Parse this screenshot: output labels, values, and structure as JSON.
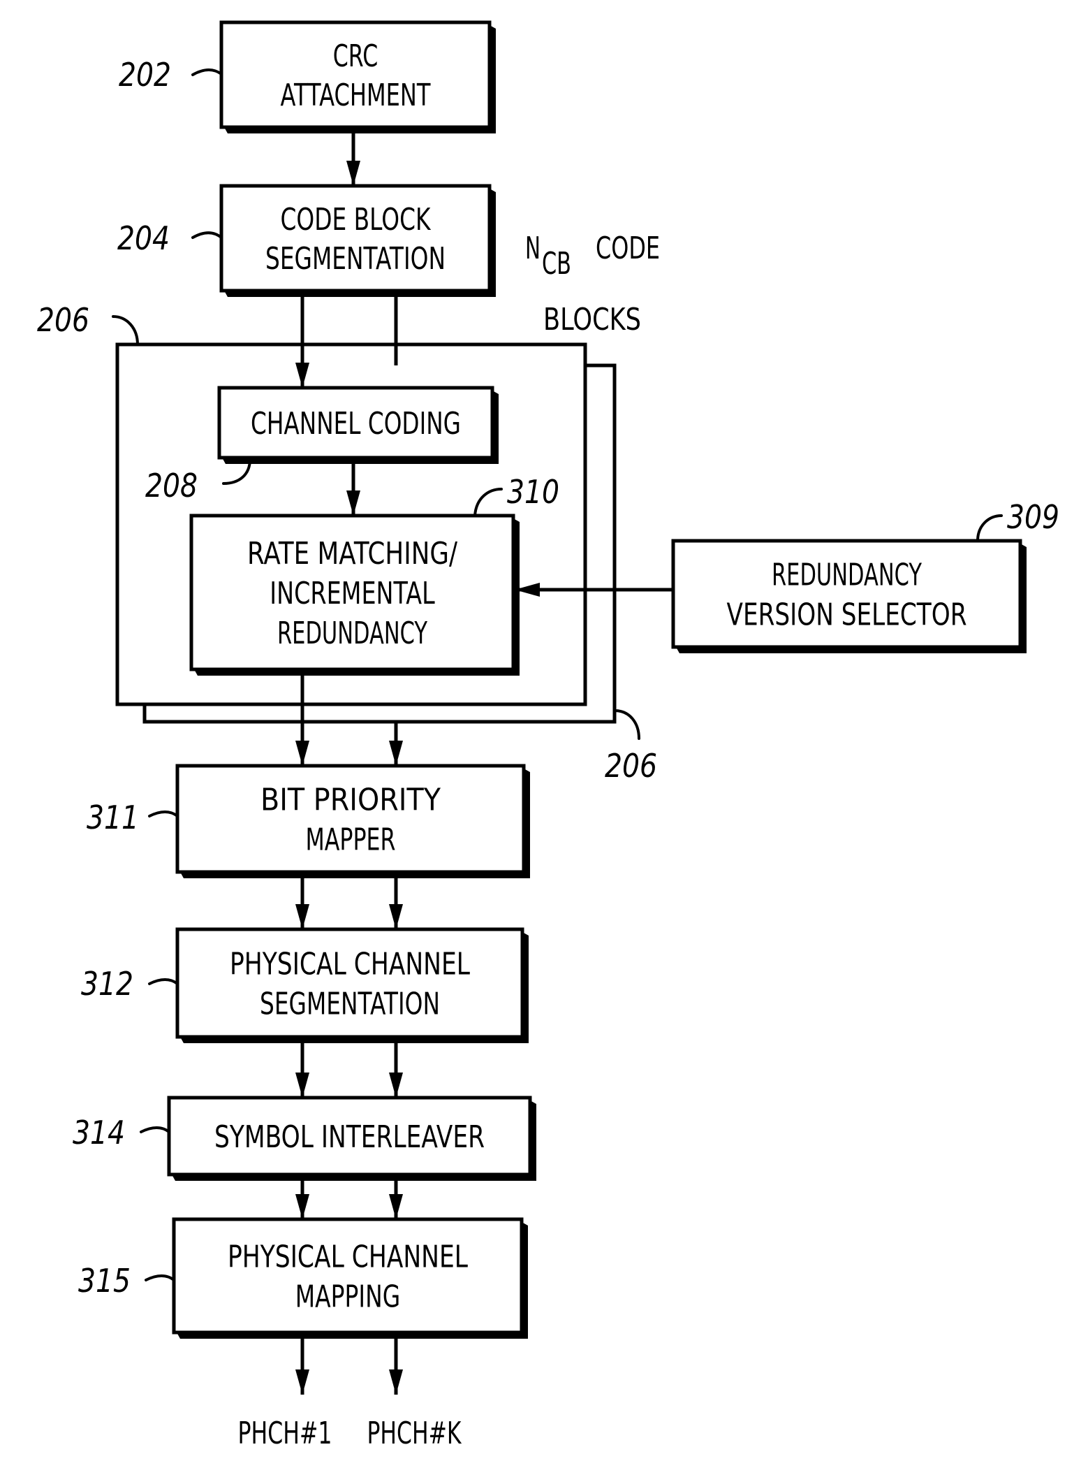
{
  "figure": {
    "type": "block-diagram",
    "description": "Transport channel processing chain with redundancy version selection"
  },
  "blocks": {
    "crc_attachment": {
      "ref": "202",
      "lines": [
        "CRC",
        "ATTACHMENT"
      ]
    },
    "code_block_segmentation": {
      "ref": "204",
      "lines": [
        "CODE BLOCK",
        "SEGMENTATION"
      ]
    },
    "per_code_block_container": {
      "ref_front": "206",
      "ref_back": "206"
    },
    "channel_coding": {
      "ref": "208",
      "lines": [
        "CHANNEL CODING"
      ]
    },
    "rate_matching": {
      "ref": "310",
      "lines": [
        "RATE MATCHING/",
        "INCREMENTAL",
        "REDUNDANCY"
      ]
    },
    "redundancy_version_selector": {
      "ref": "309",
      "lines": [
        "REDUNDANCY",
        "VERSION SELECTOR"
      ]
    },
    "bit_priority_mapper": {
      "ref": "311",
      "lines": [
        "BIT PRIORITY",
        "MAPPER"
      ]
    },
    "physical_channel_segmentation": {
      "ref": "312",
      "lines": [
        "PHYSICAL CHANNEL",
        "SEGMENTATION"
      ]
    },
    "symbol_interleaver": {
      "ref": "314",
      "lines": [
        "SYMBOL INTERLEAVER"
      ]
    },
    "physical_channel_mapping": {
      "ref": "315",
      "lines": [
        "PHYSICAL CHANNEL",
        "MAPPING"
      ]
    }
  },
  "annotations": {
    "code_blocks_note": {
      "main": "N",
      "subscript": "CB",
      "line1_rest": "CODE",
      "line2": "BLOCKS"
    }
  },
  "outputs": [
    "PHCH#1",
    "PHCH#K"
  ],
  "connections": [
    {
      "from": "crc_attachment",
      "to": "code_block_segmentation"
    },
    {
      "from": "code_block_segmentation",
      "to": "channel_coding"
    },
    {
      "from": "channel_coding",
      "to": "rate_matching"
    },
    {
      "from": "redundancy_version_selector",
      "to": "rate_matching"
    },
    {
      "from": "rate_matching",
      "to": "bit_priority_mapper"
    },
    {
      "from": "bit_priority_mapper",
      "to": "physical_channel_segmentation"
    },
    {
      "from": "physical_channel_segmentation",
      "to": "symbol_interleaver"
    },
    {
      "from": "symbol_interleaver",
      "to": "physical_channel_mapping"
    },
    {
      "from": "physical_channel_mapping",
      "to": "PHCH#1"
    },
    {
      "from": "physical_channel_mapping",
      "to": "PHCH#K"
    }
  ]
}
